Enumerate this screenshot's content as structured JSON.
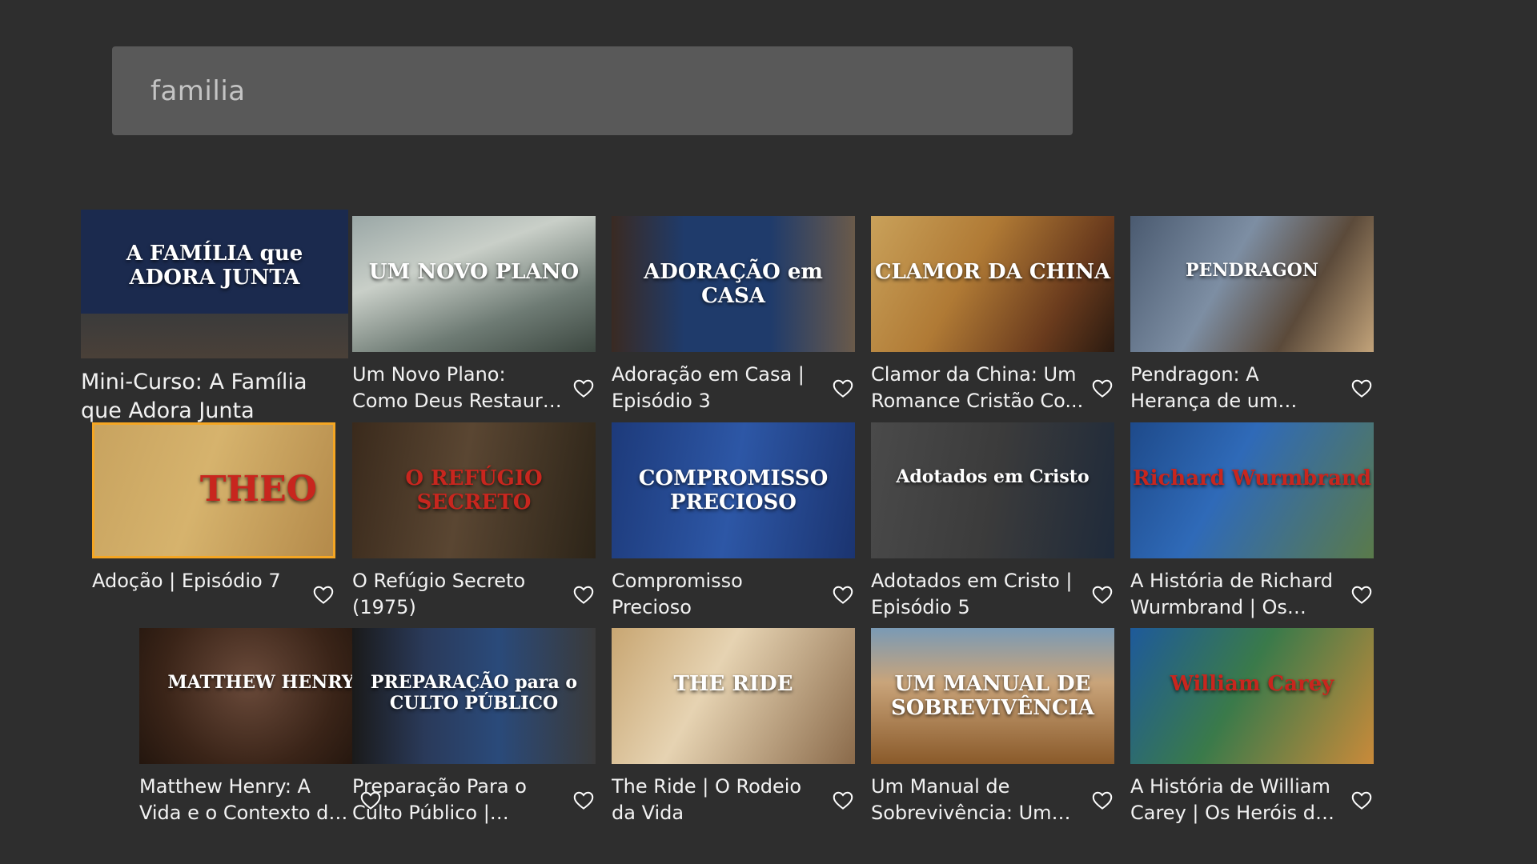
{
  "search": {
    "value": "familia"
  },
  "colors": {
    "background": "#2e2e2e",
    "search_bg": "#595959",
    "focus": "#f5a623"
  },
  "results": [
    {
      "title": "Mini-Curso: A Família que Adora Junta",
      "thumb_text": "A FAMÍLIA que ADORA JUNTA",
      "thumb_bg": "linear-gradient(#1b2a4e 0%,#1b2a4e 70%,#3b3b3b 70%,#4a4038 100%)",
      "favorite": false
    },
    {
      "title": "Um Novo Plano: Como Deus Restaura Famíli...",
      "thumb_text": "UM NOVO PLANO",
      "thumb_bg": "linear-gradient(160deg,#9aa7a6 0%,#c9cfc8 35%,#6e7b74 70%,#3c4740 100%)",
      "favorite": false
    },
    {
      "title": "Adoração em Casa | Episódio 3",
      "thumb_text": "ADORAÇÃO em CASA",
      "thumb_bg": "linear-gradient(90deg,#3a2a22 0%,#1f3b6b 30%,#1f3b6b 65%,#6a5a4a 100%)",
      "favorite": false
    },
    {
      "title": "Clamor da China: Um Romance Cristão Co...",
      "thumb_text": "CLAMOR DA CHINA",
      "thumb_bg": "linear-gradient(120deg,#c9a15a 0%,#b07a35 40%,#6a3b1d 75%,#2a1a10 100%)",
      "favorite": false
    },
    {
      "title": "Pendragon: A Herança de um Guerreiro",
      "thumb_text": "PENDRAGON",
      "thumb_bg": "linear-gradient(120deg,#4a5a70 0%,#7d8ea3 40%,#5b4a3a 70%,#c2a37a 100%)",
      "favorite": false
    },
    {
      "title": "Adoção | Episódio 7",
      "thumb_text": "THEO",
      "thumb_bg": "linear-gradient(110deg,#c8a35f 0%,#d6b36d 45%,#b48a4a 100%)",
      "favorite": false
    },
    {
      "title": "O Refúgio Secreto (1975)",
      "thumb_text": "O REFÚGIO SECRETO",
      "thumb_bg": "linear-gradient(100deg,#3a2a1c 0%,#5a4632 45%,#2c2418 100%)",
      "favorite": false
    },
    {
      "title": "Compromisso Precioso",
      "thumb_text": "COMPROMISSO PRECIOSO",
      "thumb_bg": "linear-gradient(100deg,#1d3a7a 0%,#2d57a6 50%,#1b3470 100%)",
      "favorite": false
    },
    {
      "title": "Adotados em Cristo | Episódio 5",
      "thumb_text": "Adotados em Cristo",
      "thumb_bg": "linear-gradient(100deg,#4a4a4a 0%,#3b3b3b 50%,#1f2a3a 100%)",
      "favorite": false
    },
    {
      "title": "A História de Richard Wurmbrand | Os Heró...",
      "thumb_text": "Richard Wurmbrand",
      "thumb_bg": "linear-gradient(120deg,#1e4a8a 0%,#2f6ab8 40%,#5a7a4a 100%)",
      "favorite": false
    },
    {
      "title": "Matthew Henry: A Vida e o Contexto do Com...",
      "thumb_text": "MATTHEW HENRY",
      "thumb_bg": "radial-gradient(circle at 45% 40%,#6a4a3a 0%,#3a2418 55%,#1a100a 100%)",
      "favorite": false
    },
    {
      "title": "Preparação Para o Culto Público | Episódi...",
      "thumb_text": "PREPARAÇÃO para o CULTO PÚBLICO",
      "thumb_bg": "linear-gradient(90deg,#1a1a1a 0%,#2a3a5a 30%,#2a4a7a 60%,#3a3a3a 100%)",
      "favorite": false
    },
    {
      "title": "The Ride | O Rodeio da Vida",
      "thumb_text": "THE RIDE",
      "thumb_bg": "linear-gradient(120deg,#c8a672 0%,#e6d3b2 40%,#8a6a4a 100%)",
      "favorite": false
    },
    {
      "title": "Um Manual de Sobrevivência: Um Cl...",
      "thumb_text": "UM MANUAL DE SOBREVIVÊNCIA",
      "thumb_bg": "linear-gradient(180deg,#7a9ab5 0%,#c9a47a 40%,#8a5a2a 100%)",
      "favorite": false
    },
    {
      "title": "A História de William Carey | Os Heróis da ...",
      "thumb_text": "William Carey",
      "thumb_bg": "linear-gradient(120deg,#1e5a9a 0%,#3a7a4a 45%,#c98a3a 100%)",
      "favorite": false
    }
  ]
}
